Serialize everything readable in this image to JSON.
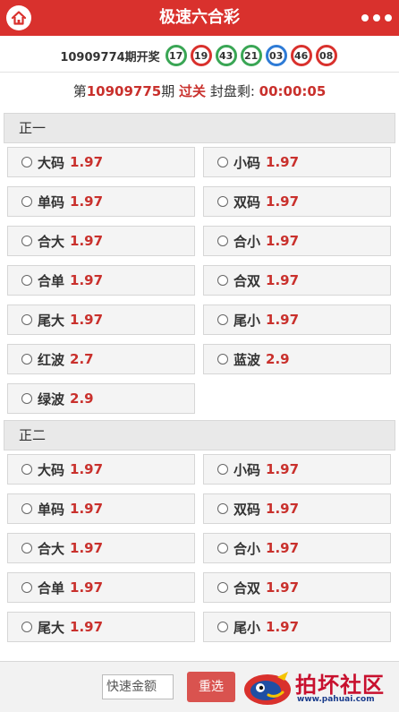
{
  "header": {
    "title": "极速六合彩",
    "home_icon": "home-icon",
    "more_icon": "more-dots-icon",
    "color": "#d9312d"
  },
  "draw": {
    "label": "10909774期开奖",
    "balls": [
      {
        "number": "17",
        "color": "#3aa655"
      },
      {
        "number": "19",
        "color": "#d9312d"
      },
      {
        "number": "43",
        "color": "#3aa655"
      },
      {
        "number": "21",
        "color": "#3aa655"
      },
      {
        "number": "03",
        "color": "#2e7bd6"
      },
      {
        "number": "46",
        "color": "#d9312d"
      },
      {
        "number": "08",
        "color": "#d9312d"
      }
    ]
  },
  "period": {
    "prefix": "第",
    "number": "10909775",
    "suffix": "期",
    "status": "过关",
    "countdown_label": "封盘剩:",
    "countdown": "00:00:05"
  },
  "sections": [
    {
      "title": "正一",
      "options": [
        {
          "label": "大码",
          "odds": "1.97"
        },
        {
          "label": "小码",
          "odds": "1.97"
        },
        {
          "label": "单码",
          "odds": "1.97"
        },
        {
          "label": "双码",
          "odds": "1.97"
        },
        {
          "label": "合大",
          "odds": "1.97"
        },
        {
          "label": "合小",
          "odds": "1.97"
        },
        {
          "label": "合单",
          "odds": "1.97"
        },
        {
          "label": "合双",
          "odds": "1.97"
        },
        {
          "label": "尾大",
          "odds": "1.97"
        },
        {
          "label": "尾小",
          "odds": "1.97"
        },
        {
          "label": "红波",
          "odds": "2.7"
        },
        {
          "label": "蓝波",
          "odds": "2.9"
        },
        {
          "label": "绿波",
          "odds": "2.9"
        }
      ]
    },
    {
      "title": "正二",
      "options": [
        {
          "label": "大码",
          "odds": "1.97"
        },
        {
          "label": "小码",
          "odds": "1.97"
        },
        {
          "label": "单码",
          "odds": "1.97"
        },
        {
          "label": "双码",
          "odds": "1.97"
        },
        {
          "label": "合大",
          "odds": "1.97"
        },
        {
          "label": "合小",
          "odds": "1.97"
        },
        {
          "label": "合单",
          "odds": "1.97"
        },
        {
          "label": "合双",
          "odds": "1.97"
        },
        {
          "label": "尾大",
          "odds": "1.97"
        },
        {
          "label": "尾小",
          "odds": "1.97"
        }
      ]
    }
  ],
  "bottom": {
    "amount_placeholder": "快速金额",
    "reset_label": "重选"
  },
  "watermark": {
    "title": "拍坏社区",
    "url": "www.pahuai.com"
  }
}
